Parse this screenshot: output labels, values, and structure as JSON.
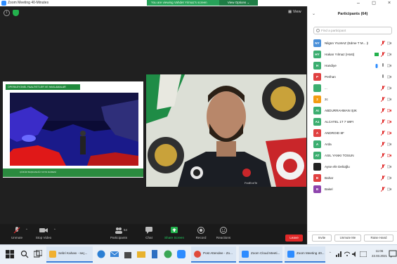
{
  "window": {
    "title": "Zoom Meeting 40-Minutes",
    "controls": {
      "minimize": "–",
      "maximize": "◻",
      "close": "×"
    }
  },
  "share_banner": {
    "text": "You are viewing Vahdet Yılmaz's screen",
    "options_label": "View Options ⌄"
  },
  "meeting": {
    "view_label": "View",
    "shared_heading": "OPERASYONEL FAALİYETLER VE HAKLAMALAR",
    "shared_footer_text": "ÇÖZÜM BAŞKANLIĞI YAYIN DAİRESİ",
    "speaker_nameplate": "FedEnriTe"
  },
  "controls": {
    "unmute": "Unmute",
    "stop_video": "Stop Video",
    "participants": "Participants",
    "participants_count": "64",
    "chat": "Chat",
    "share_screen": "Share Screen",
    "record": "Record",
    "reactions": "Reactions",
    "leave": "Leave"
  },
  "participants_panel": {
    "header": "Participants (64)",
    "search_placeholder": "Find a participant",
    "items": [
      {
        "initials": "NY",
        "name": "Nilgün YILMAZ (Edme T M... (Me)",
        "color": "#4a90d9"
      },
      {
        "initials": "HY",
        "name": "Hakan Yılmaz (Host)",
        "color": "#3cae70"
      },
      {
        "initials": "H",
        "name": "Handiye",
        "color": "#3cae70"
      },
      {
        "initials": "P",
        "name": "Perihan",
        "color": "#e04040"
      },
      {
        "initials": "",
        "name": "...",
        "color": "#3cae70"
      },
      {
        "initials": "2",
        "name": "2c",
        "color": "#f39c12"
      },
      {
        "initials": "AI",
        "name": "ABDURRAHMAN IŞIK",
        "color": "#3cae70"
      },
      {
        "initials": "A1",
        "name": "ALCATEL 1T 7 WIFI",
        "color": "#3cae70"
      },
      {
        "initials": "A",
        "name": "ANDROID 8F",
        "color": "#e04040"
      },
      {
        "initials": "A",
        "name": "Arda",
        "color": "#3cae70"
      },
      {
        "initials": "AT",
        "name": "ASIL YANKI TOSUN",
        "color": "#3cae70"
      },
      {
        "initials": "",
        "name": "Ayse efe Delioğlu",
        "color": "#222222"
      },
      {
        "initials": "B",
        "name": "Bahar",
        "color": "#e04040"
      },
      {
        "initials": "B",
        "name": "Bakel",
        "color": "#8e44ad"
      }
    ],
    "footer": {
      "invite": "Invite",
      "unmute_me": "Unmute Me",
      "raise_hand": "Raise Hand"
    }
  },
  "taskbar": {
    "tasks": [
      {
        "label": "Sebri Kahası - seç...",
        "color": "#f0b030"
      },
      {
        "label": "Post Attendee - Zo...",
        "color": "#e04a3a"
      },
      {
        "label": "Zoom Cloud Meeti...",
        "color": "#2d8cff"
      },
      {
        "label": "Zoom Meeting 40...",
        "color": "#2d8cff"
      }
    ],
    "time": "11:06",
    "date": "22.03.2021"
  },
  "colors": {
    "accent": "#2d8cff",
    "share_green": "#23d160",
    "leave_red": "#e02828"
  }
}
